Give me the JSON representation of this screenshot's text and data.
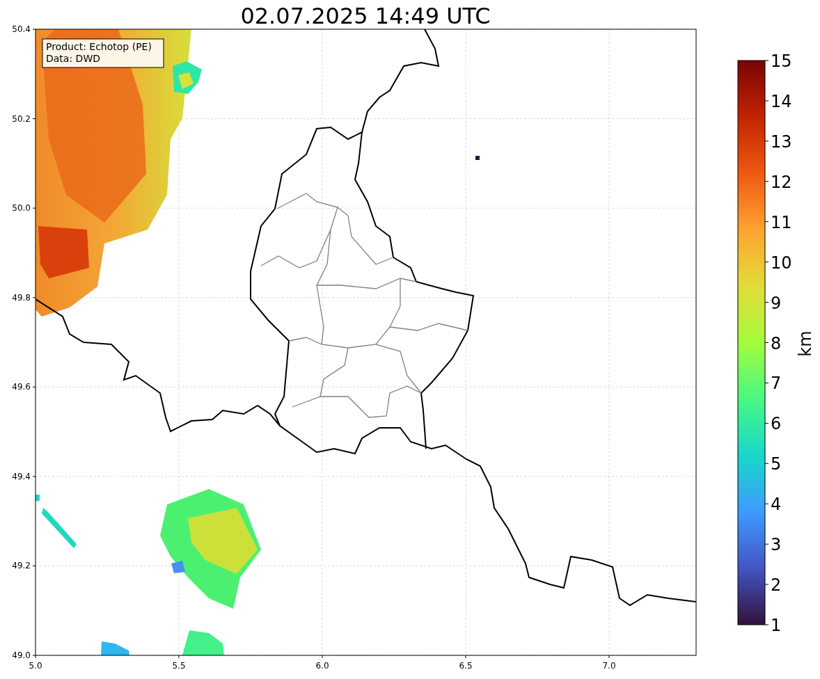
{
  "title": "02.07.2025 14:49 UTC",
  "info_box": {
    "lines": [
      "Product: Echotop (PE)",
      "Data: DWD"
    ]
  },
  "x_ticks": [
    "5.0",
    "5.5",
    "6.0",
    "6.5",
    "7.0"
  ],
  "y_ticks": [
    "50.4",
    "50.2",
    "50.0",
    "49.8",
    "49.6",
    "49.4",
    "49.2",
    "49.0"
  ],
  "colorbar": {
    "label": "km",
    "ticks": [
      "15",
      "14",
      "13",
      "12",
      "11",
      "10",
      "9",
      "8",
      "7",
      "6",
      "5",
      "4",
      "3",
      "2",
      "1"
    ]
  }
}
